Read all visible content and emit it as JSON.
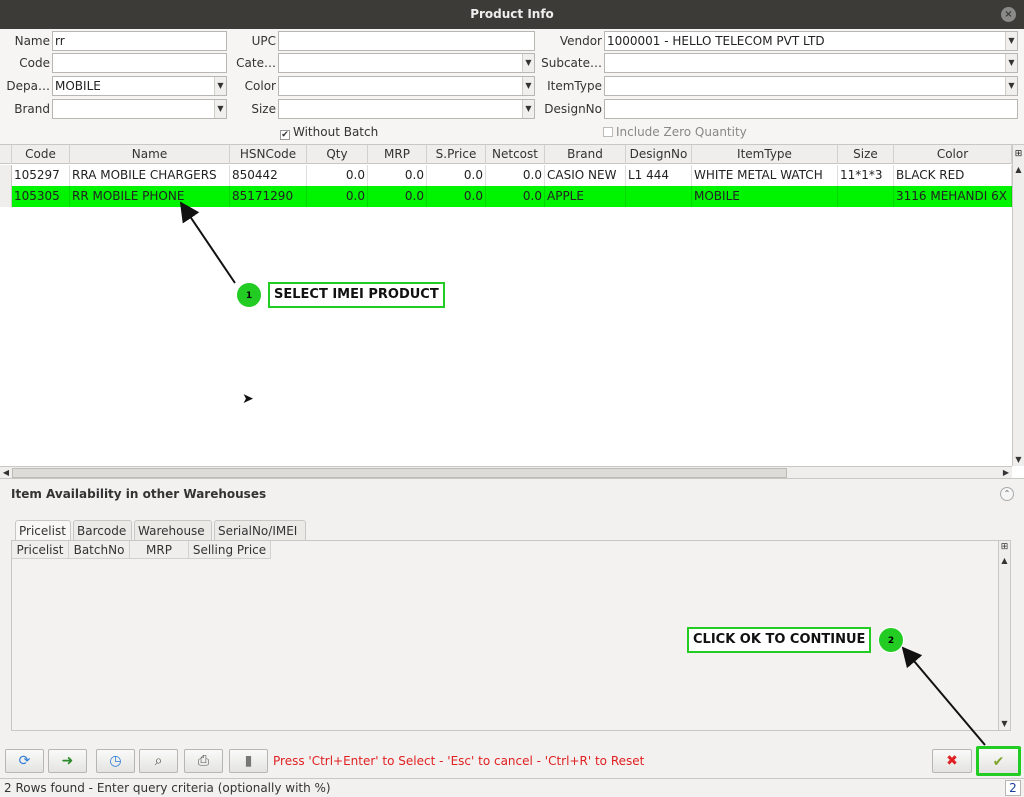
{
  "window": {
    "title": "Product Info",
    "close": "×"
  },
  "criteria": {
    "name_label": "Name",
    "name_value": "rr",
    "upc_label": "UPC",
    "upc_value": "",
    "vendor_label": "Vendor",
    "vendor_value": "1000001 - HELLO TELECOM PVT LTD",
    "code_label": "Code",
    "code_value": "",
    "category_label": "Cate…",
    "category_value": "",
    "subcategory_label": "Subcate…",
    "subcategory_value": "",
    "department_label": "Depa…",
    "department_value": "MOBILE",
    "color_label": "Color",
    "color_value": "",
    "itemtype_label": "ItemType",
    "itemtype_value": "",
    "brand_label": "Brand",
    "brand_value": "",
    "size_label": "Size",
    "size_value": "",
    "designno_label": "DesignNo",
    "designno_value": "",
    "without_batch_label": "Without Batch",
    "without_batch_checked": true,
    "include_zero_label": "Include Zero Quantity",
    "include_zero_checked": false
  },
  "grid": {
    "columns": [
      "Code",
      "Name",
      "HSNCode",
      "Qty",
      "MRP",
      "S.Price",
      "Netcost",
      "Brand",
      "DesignNo",
      "ItemType",
      "Size",
      "Color"
    ],
    "rows": [
      {
        "code": "105297",
        "name": "RRA MOBILE CHARGERS",
        "hsn": "850442",
        "qty": "0.0",
        "mrp": "0.0",
        "sprice": "0.0",
        "netcost": "0.0",
        "brand": "CASIO NEW",
        "designno": "L1 444",
        "itemtype": "WHITE METAL WATCH",
        "size": "11*1*3",
        "color": "BLACK RED"
      },
      {
        "code": "105305",
        "name": "RR MOBILE PHONE",
        "hsn": "85171290",
        "qty": "0.0",
        "mrp": "0.0",
        "sprice": "0.0",
        "netcost": "0.0",
        "brand": "APPLE",
        "designno": "",
        "itemtype": "MOBILE",
        "size": "",
        "color": "3116 MEHANDI 6X"
      }
    ],
    "selected_row_color": "#00f400"
  },
  "availability": {
    "title": "Item Availability in other Warehouses",
    "tabs": [
      "Pricelist",
      "Barcode",
      "Warehouse",
      "SerialNo/IMEI"
    ],
    "active_tab": "Pricelist",
    "columns": [
      "Pricelist",
      "BatchNo",
      "MRP",
      "Selling Price"
    ]
  },
  "toolbar": {
    "icons": [
      "refresh-icon",
      "redo-icon",
      "history-icon",
      "zoom-icon",
      "print-icon",
      "delete-icon"
    ],
    "hint": "Press 'Ctrl+Enter' to Select - 'Esc' to cancel - 'Ctrl+R' to Reset",
    "cancel_icon": "✖",
    "ok_icon": "✔"
  },
  "status": {
    "message": "2 Rows found - Enter query criteria (optionally with %)",
    "count": "2"
  },
  "annotations": [
    {
      "number": "1",
      "text": "SELECT IMEI PRODUCT"
    },
    {
      "number": "2",
      "text": "CLICK OK TO CONTINUE"
    }
  ],
  "accent_color": "#22cc22"
}
